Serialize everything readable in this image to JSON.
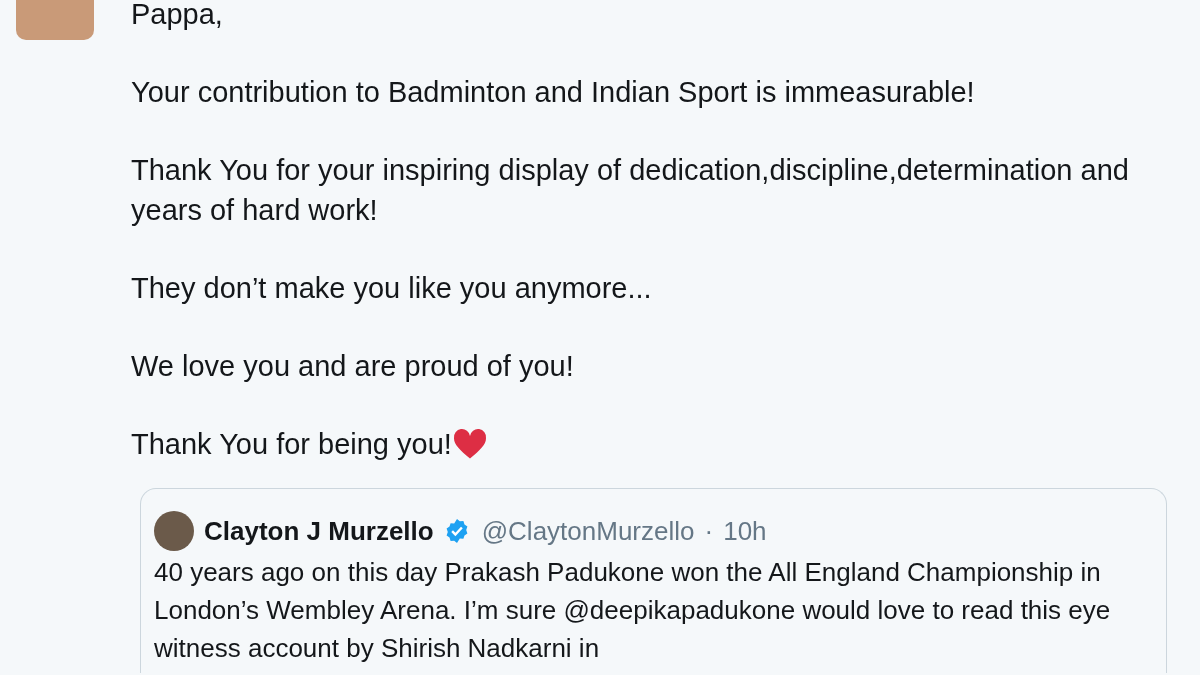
{
  "tweet": {
    "paragraphs": [
      "Pappa,",
      "Your contribution to Badminton and Indian Sport is immeasurable!",
      "Thank You for your inspiring display of dedication,discipline,determination and years of hard work!",
      "They don’t make you like you anymore...",
      "We love you and are proud of you!",
      "Thank You for being you!"
    ],
    "quoted_tweet": {
      "name": "Clayton J Murzello",
      "verified": true,
      "handle": "@ClaytonMurzello",
      "separator": "·",
      "time": "10h",
      "text": "40 years ago on this day Prakash Padukone won the All England Championship in London’s Wembley Arena. I’m sure @deepikapadukone would love to read this eye witness account by Shirish Nadkarni in"
    }
  }
}
